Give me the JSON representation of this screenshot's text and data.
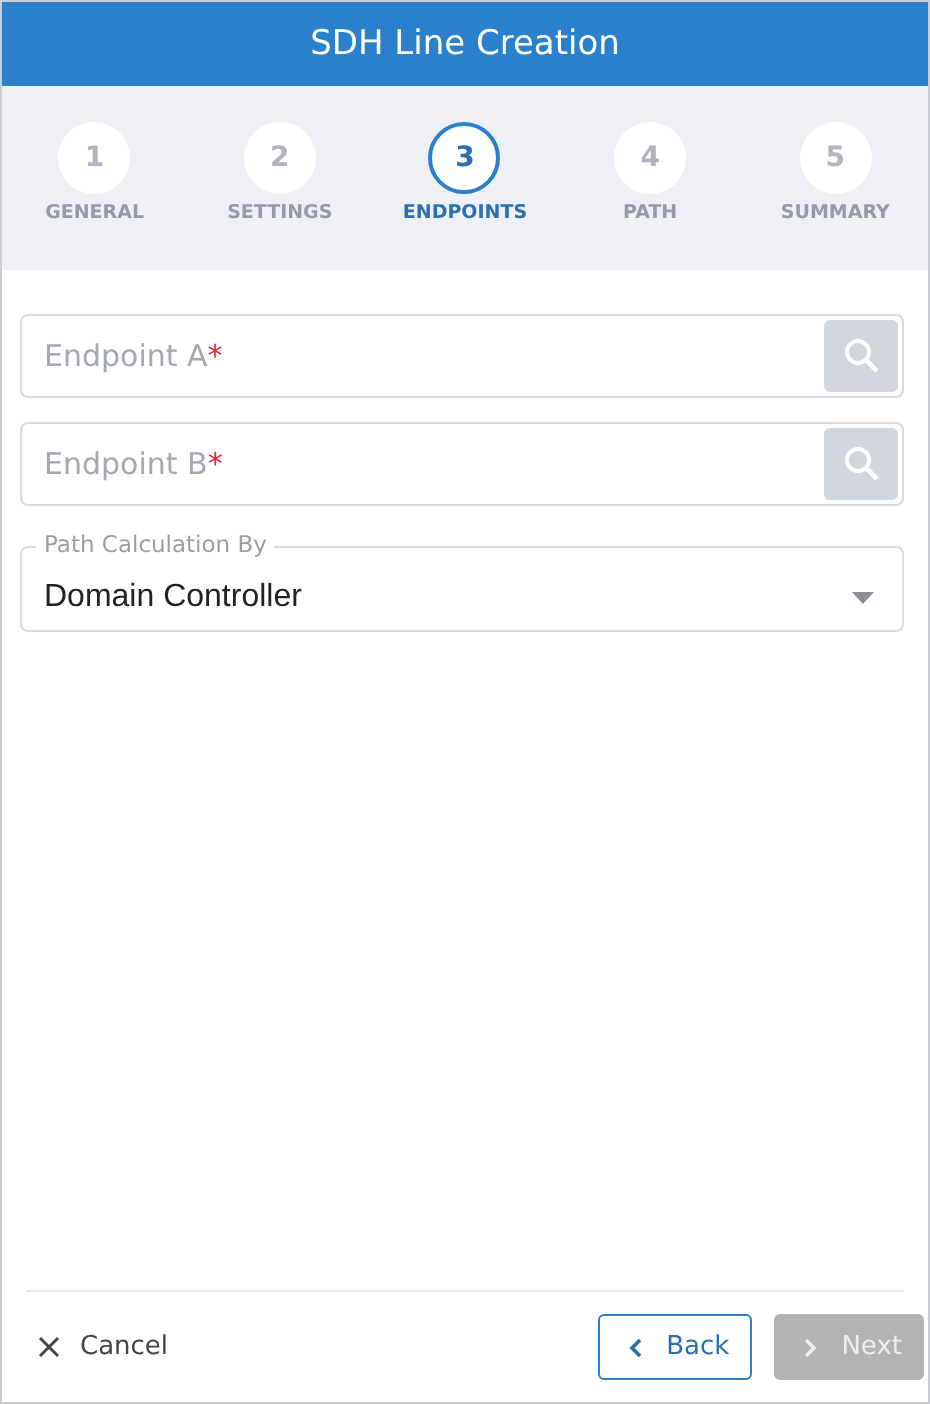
{
  "window": {
    "title": "SDH Line Creation"
  },
  "steps": [
    {
      "number": "1",
      "label": "GENERAL",
      "selected": false
    },
    {
      "number": "2",
      "label": "SETTINGS",
      "selected": false
    },
    {
      "number": "3",
      "label": "ENDPOINTS",
      "selected": true
    },
    {
      "number": "4",
      "label": "PATH",
      "selected": false
    },
    {
      "number": "5",
      "label": "SUMMARY",
      "selected": false
    }
  ],
  "fields": [
    {
      "kind": "search",
      "placeholder": "Endpoint A",
      "required_mark": "*"
    },
    {
      "kind": "search",
      "placeholder": "Endpoint B",
      "required_mark": "*"
    },
    {
      "kind": "select",
      "label": "Path Calculation By",
      "value": "Domain Controller"
    }
  ],
  "footer": {
    "cancel": "Cancel",
    "back": {
      "label": "Back",
      "disabled": false
    },
    "next": {
      "label": "Next",
      "disabled": true
    }
  }
}
